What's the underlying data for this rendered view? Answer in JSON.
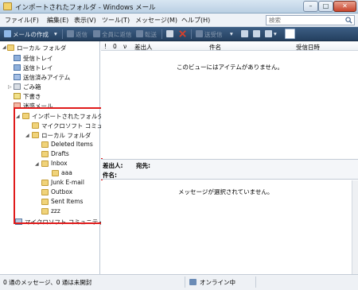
{
  "window": {
    "title": "インポートされたフォルダ - Windows メール",
    "buttons": {
      "minimize": "–",
      "maximize": "□",
      "close": "✕"
    }
  },
  "menu": [
    "ファイル(F)",
    "編集(E)",
    "表示(V)",
    "ツール(T)",
    "メッセージ(M)",
    "ヘルプ(H)"
  ],
  "search": {
    "placeholder": "検索"
  },
  "toolbar": {
    "create_mail": "メールの作成",
    "reply": "返信",
    "reply_all": "全員に返信",
    "forward": "転送",
    "send_receive": "送受信"
  },
  "folders": {
    "root": "ローカル フォルダ",
    "inbox": "受信トレイ",
    "outbox": "送信トレイ",
    "sent": "送信済みアイテム",
    "trash": "ごみ箱",
    "drafts": "下書き",
    "junk": "迷惑メール",
    "imported": "インポートされたフォルダ",
    "ms_community_sub": "マイクロソフト コミュニティ",
    "local_sub": "ローカル フォルダ",
    "deleted_items": "Deleted Items",
    "drafts_en": "Drafts",
    "inbox_en": "Inbox",
    "aaa": "aaa",
    "junk_email": "Junk E-mail",
    "outbox_en": "Outbox",
    "sent_items": "Sent Items",
    "zzz": "zzz",
    "ms_community": "マイクロソフト コミュニティ"
  },
  "columns": {
    "flag": "!",
    "attach": "0",
    "watch": "ν",
    "from": "差出人",
    "subject": "件名",
    "date": "受信日時"
  },
  "message_list": {
    "empty_text": "このビューにはアイテムがありません。"
  },
  "preview": {
    "from_label": "差出人:",
    "to_label": "宛先:",
    "subject_label": "件名:",
    "empty_text": "メッセージが選択されていません。"
  },
  "status": {
    "counts": "0 通のメッセージ、0 通は未開封",
    "online": "オンライン中"
  }
}
